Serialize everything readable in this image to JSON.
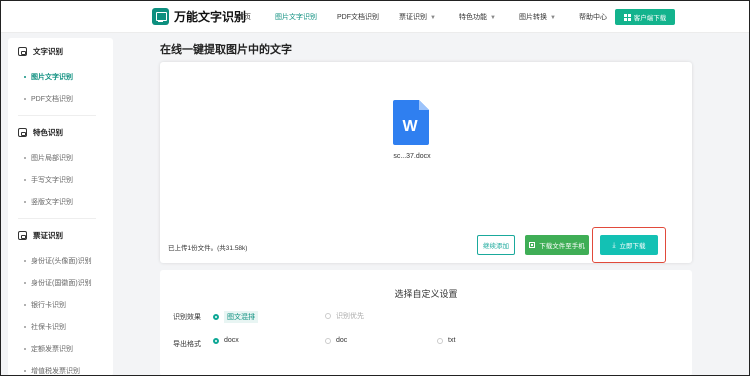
{
  "header": {
    "logo_text": "万能文字识别",
    "nav": [
      {
        "label": "首页",
        "active": false,
        "dropdown": false
      },
      {
        "label": "图片文字识别",
        "active": true,
        "dropdown": false
      },
      {
        "label": "PDF文档识别",
        "active": false,
        "dropdown": false
      },
      {
        "label": "票证识别",
        "active": false,
        "dropdown": true
      },
      {
        "label": "特色功能",
        "active": false,
        "dropdown": true
      },
      {
        "label": "图片转换",
        "active": false,
        "dropdown": true
      },
      {
        "label": "帮助中心",
        "active": false,
        "dropdown": false
      }
    ],
    "client_button": "客户端下载",
    "accent_color": "#0d8f7f"
  },
  "sidebar": {
    "sections": [
      {
        "title": "文字识别",
        "icon": "scan-icon",
        "items": [
          {
            "label": "图片文字识别",
            "active": true
          },
          {
            "label": "PDF文档识别",
            "active": false
          }
        ]
      },
      {
        "title": "特色识别",
        "icon": "scan-icon",
        "items": [
          {
            "label": "图片局部识别",
            "active": false
          },
          {
            "label": "手写文字识别",
            "active": false
          },
          {
            "label": "竖版文字识别",
            "active": false
          }
        ]
      },
      {
        "title": "票证识别",
        "icon": "card-icon",
        "items": [
          {
            "label": "身份证(头像面)识别",
            "active": false
          },
          {
            "label": "身份证(国徽面)识别",
            "active": false
          },
          {
            "label": "银行卡识别",
            "active": false
          },
          {
            "label": "社保卡识别",
            "active": false
          },
          {
            "label": "定额发票识别",
            "active": false
          },
          {
            "label": "增值税发票识别",
            "active": false
          }
        ]
      }
    ]
  },
  "main": {
    "title": "在线一键提取图片中的文字",
    "file": {
      "name": "sc...37.docx",
      "icon": "word-doc-icon",
      "icon_letter": "W"
    },
    "upload_info": "已上传1份文件。(共31.58k)",
    "buttons": {
      "continue_add": "继续添加",
      "download_to_phone": "下载文件至手机",
      "download_now": "立即下载"
    }
  },
  "settings": {
    "title": "选择自定义设置",
    "effect_label": "识别效果",
    "effect_options": [
      {
        "label": "图文混排",
        "selected": true
      },
      {
        "label": "识别优先",
        "selected": false
      }
    ],
    "format_label": "导出格式",
    "format_options": [
      {
        "label": "docx",
        "selected": true
      },
      {
        "label": "doc",
        "selected": false
      },
      {
        "label": "txt",
        "selected": false
      }
    ]
  }
}
